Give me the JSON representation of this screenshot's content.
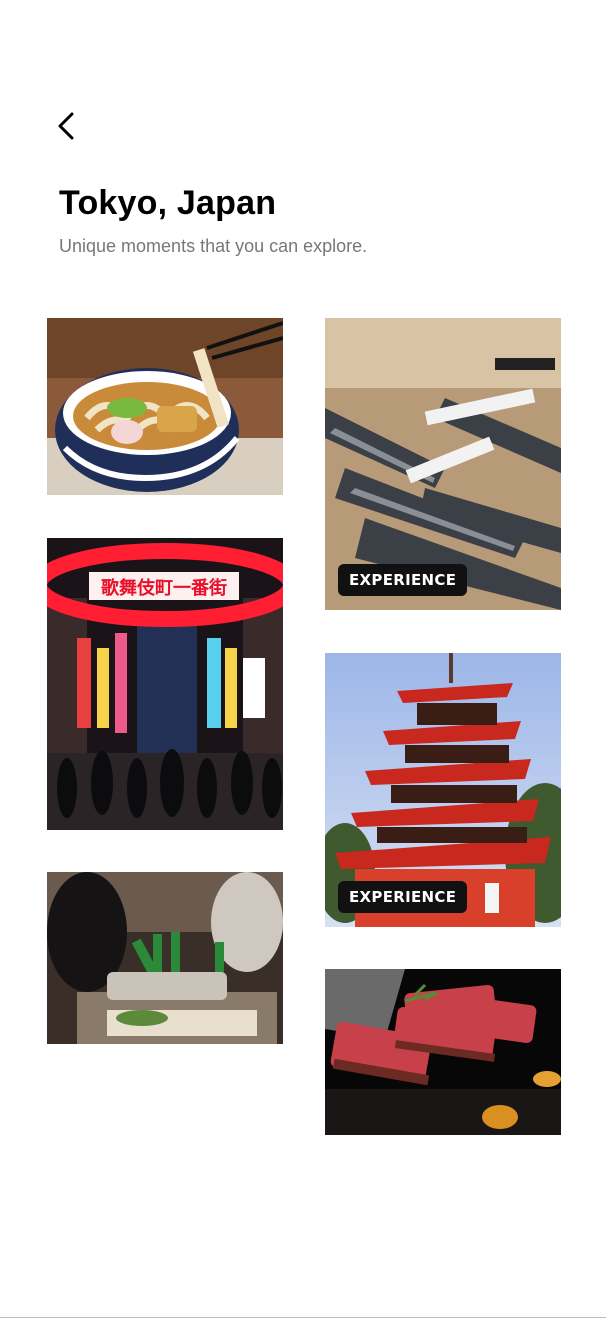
{
  "header": {
    "back_icon": "chevron-left-icon"
  },
  "page": {
    "title": "Tokyo, Japan",
    "subtitle": "Unique moments that you can explore."
  },
  "tiles": [
    {
      "id": "udon",
      "subject": "udon noodle bowl"
    },
    {
      "id": "fish-market",
      "subject": "dried fish market",
      "badge": "EXPERIENCE"
    },
    {
      "id": "kabukicho",
      "subject": "Kabukicho neon street",
      "sign_text": "歌舞伎町一番街"
    },
    {
      "id": "pagoda",
      "subject": "red five-story pagoda",
      "badge": "EXPERIENCE"
    },
    {
      "id": "sake",
      "subject": "sake tasting bar"
    },
    {
      "id": "wagyu",
      "subject": "wagyu steak on teppan"
    }
  ],
  "colors": {
    "badge_bg": "#111111",
    "subtitle": "#777777",
    "neon_red": "#e8102a"
  }
}
